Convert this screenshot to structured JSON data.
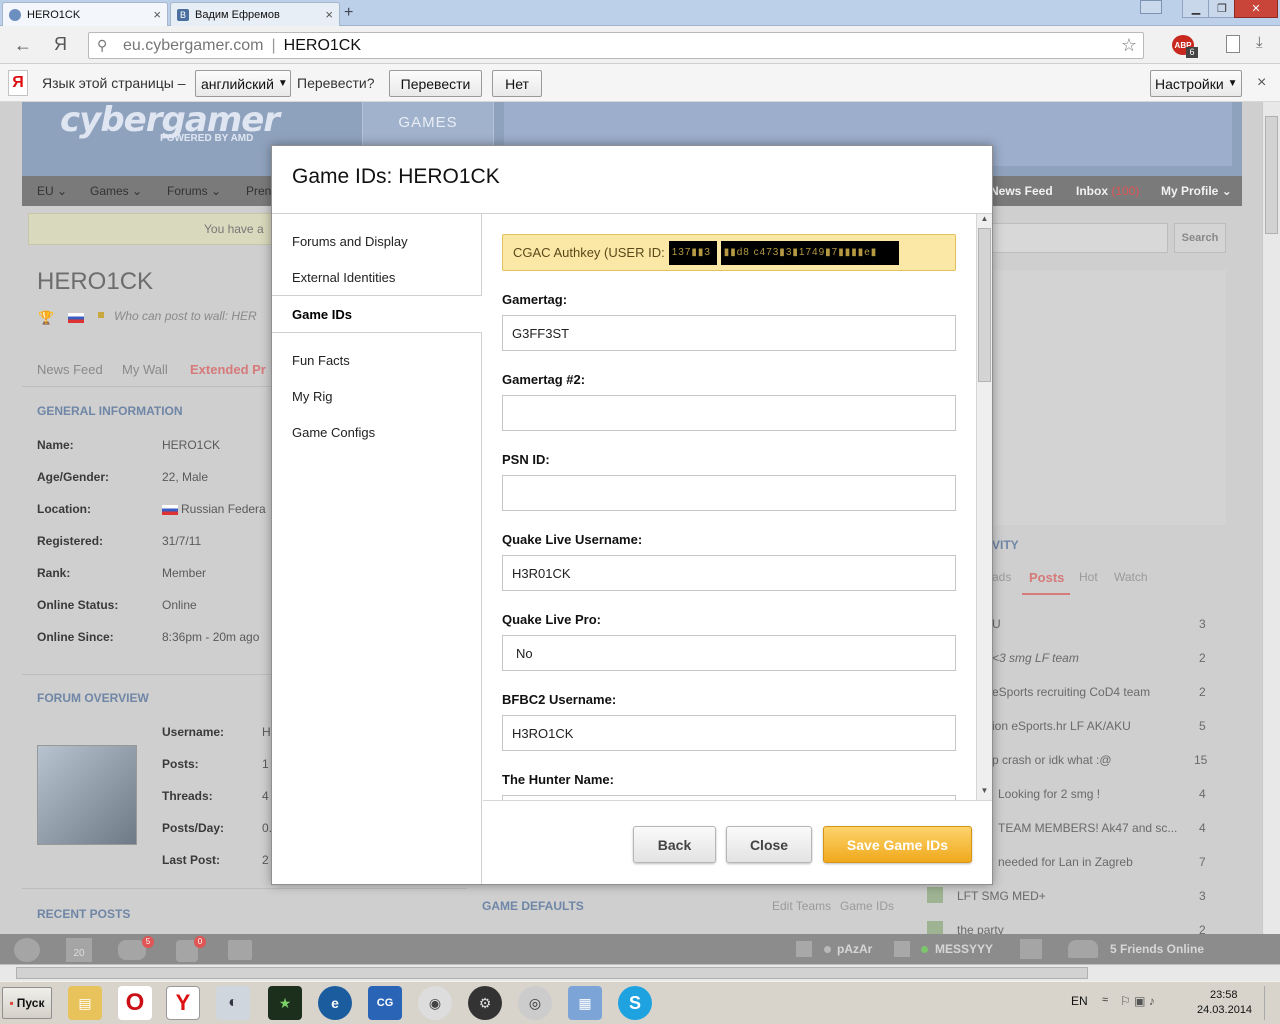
{
  "tabs": [
    {
      "label": "HERO1CK",
      "close": "×"
    },
    {
      "label": "Вадим Ефремов",
      "close": "×"
    }
  ],
  "new_tab": "+",
  "address": {
    "domain": "eu.cybergamer.com",
    "path": "HERO1CK",
    "back": "←",
    "yandex": "Я"
  },
  "abp_badge": "6",
  "translate_bar": {
    "prefix": "Язык этой страницы –",
    "language": "английский",
    "question": "Перевести?",
    "translate": "Перевести",
    "no": "Нет",
    "settings": "Настройки",
    "close": "×"
  },
  "site": {
    "logo": "cybergamer",
    "powered": "POWERED BY AMD",
    "games_tab": "GAMES",
    "nav_left": [
      "EU",
      "Games",
      "Forums",
      "Pren"
    ],
    "nav_right": [
      "News Feed",
      "Inbox",
      "My Profile"
    ],
    "inbox_count": "(100)",
    "notice": "You have a",
    "search_btn": "Search"
  },
  "profile": {
    "name": "HERO1CK",
    "wall_note": "Who can post to wall: HER",
    "tabs": [
      "News Feed",
      "My Wall",
      "Extended Pr"
    ],
    "general_title": "GENERAL INFORMATION",
    "general": [
      {
        "label": "Name:",
        "value": "HERO1CK"
      },
      {
        "label": "Age/Gender:",
        "value": "22, Male"
      },
      {
        "label": "Location:",
        "value": "Russian Federa"
      },
      {
        "label": "Registered:",
        "value": "31/7/11"
      },
      {
        "label": "Rank:",
        "value": "Member"
      },
      {
        "label": "Online Status:",
        "value": "Online"
      },
      {
        "label": "Online Since:",
        "value": "8:36pm - 20m ago"
      }
    ],
    "forum_title": "FORUM OVERVIEW",
    "forum": [
      {
        "label": "Username:",
        "value": "H"
      },
      {
        "label": "Posts:",
        "value": "1"
      },
      {
        "label": "Threads:",
        "value": "4"
      },
      {
        "label": "Posts/Day:",
        "value": "0."
      },
      {
        "label": "Last Post:",
        "value": "2"
      }
    ],
    "recent_title": "RECENT POSTS",
    "game_defaults": "GAME DEFAULTS",
    "edit_teams": "Edit Teams",
    "game_ids_link": "Game IDs"
  },
  "activity": {
    "title": "VITY",
    "tabs": [
      "ads",
      "Posts",
      "Hot",
      "Watch"
    ],
    "posts": [
      {
        "title": "U",
        "count": "3"
      },
      {
        "title": "<3 smg LF team",
        "count": "2"
      },
      {
        "title": "eSports recruiting CoD4 team",
        "count": "2"
      },
      {
        "title": "ion eSports.hr LF AK/AKU",
        "count": "5"
      },
      {
        "title": "p crash or idk what :@",
        "count": "15"
      },
      {
        "title": "Looking for 2 smg !",
        "count": "4"
      },
      {
        "title": "TEAM MEMBERS! Ak47 and sc...",
        "count": "4"
      },
      {
        "title": "needed for Lan in Zagreb",
        "count": "7"
      },
      {
        "title": "LFT SMG MED+",
        "count": "3"
      },
      {
        "title": "the party",
        "count": "2"
      }
    ]
  },
  "bottom_bar": {
    "calendar": "20",
    "badge1": "5",
    "badge2": "0",
    "friend1": "pAzAr",
    "friend2": "MESSYYY",
    "friends_online": "5 Friends Online"
  },
  "modal": {
    "title": "Game IDs: HERO1CK",
    "menu": [
      "Forums and Display",
      "External Identities",
      "Game IDs",
      "Fun Facts",
      "My Rig",
      "Game Configs"
    ],
    "auth_label": "CGAC Authkey (USER ID:",
    "redacted1": "137▮▮3",
    "redacted2": "▮▮d8 c473▮3▮1749▮7▮▮▮▮e▮",
    "fields": [
      {
        "label": "Gamertag:",
        "value": "G3FF3ST"
      },
      {
        "label": "Gamertag #2:",
        "value": ""
      },
      {
        "label": "PSN ID:",
        "value": ""
      },
      {
        "label": "Quake Live Username:",
        "value": "H3R01CK"
      },
      {
        "label": "Quake Live Pro:",
        "value": "No"
      },
      {
        "label": "BFBC2 Username:",
        "value": "H3RO1CK"
      },
      {
        "label": "The Hunter Name:",
        "value": ""
      }
    ],
    "back": "Back",
    "close": "Close",
    "save": "Save Game IDs"
  },
  "taskbar": {
    "start": "Пуск",
    "lang": "EN",
    "time": "23:58",
    "date": "24.03.2014"
  }
}
